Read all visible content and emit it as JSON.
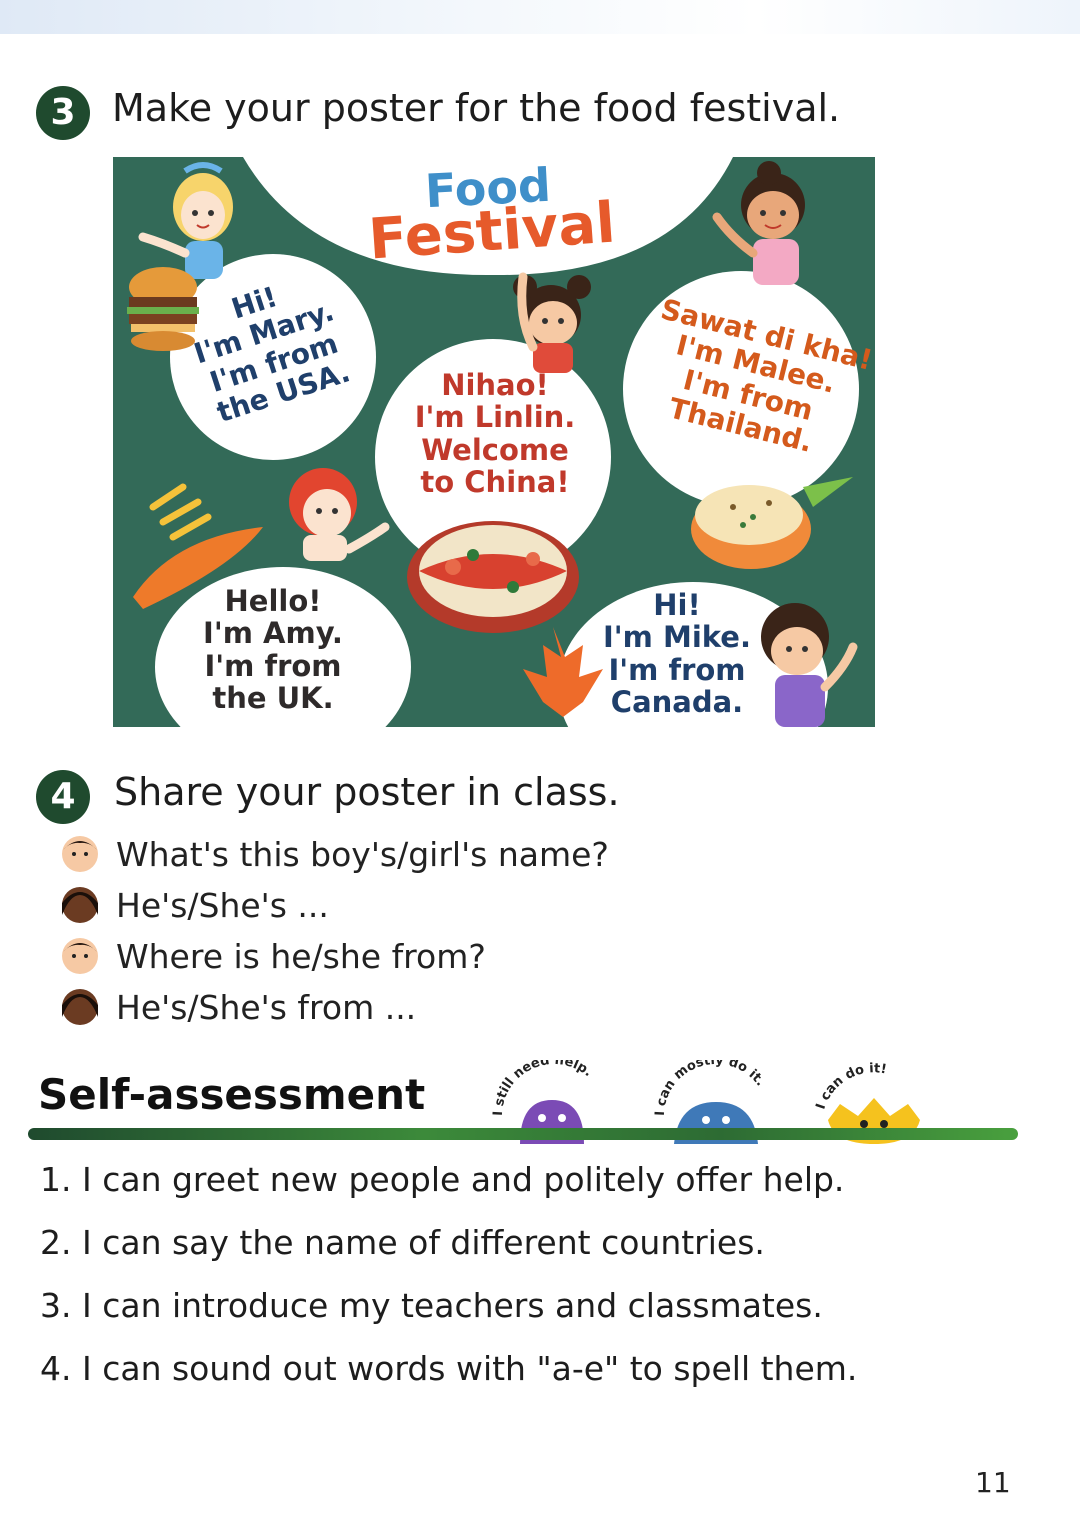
{
  "section3": {
    "number": "3",
    "title": "Make your poster for the food festival."
  },
  "poster": {
    "title_line1": "Food",
    "title_line2": "Festival",
    "bubbles": {
      "mary": [
        "Hi!",
        "I'm Mary.",
        "I'm from",
        "the USA."
      ],
      "linlin": [
        "Nihao!",
        "I'm Linlin.",
        "Welcome",
        "to China!"
      ],
      "malee": [
        "Sawat di kha!",
        "I'm Malee.",
        "I'm from",
        "Thailand."
      ],
      "amy": [
        "Hello!",
        "I'm Amy.",
        "I'm from",
        "the UK."
      ],
      "mike": [
        "Hi!",
        "I'm Mike.",
        "I'm from",
        "Canada."
      ]
    }
  },
  "section4": {
    "number": "4",
    "title": "Share your poster in class.",
    "dialogue": [
      "What's this boy's/girl's name?",
      "He's/She's ...",
      "Where is he/she from?",
      "He's/She's from ..."
    ]
  },
  "self_assessment": {
    "title": "Self-assessment",
    "ratings": [
      "I still need help.",
      "I can mostly do it.",
      "I can do it!"
    ],
    "statements": [
      "1. I can greet new people and politely offer help.",
      "2. I can say the name of different countries.",
      "3. I can introduce my teachers and classmates.",
      "4. I can sound out words with \"a-e\" to spell them."
    ]
  },
  "page_number": "11",
  "colors": {
    "poster_bg": "#336a58",
    "section_badge": "#1f4a2e",
    "title_food": "#3f8fc9",
    "title_festival": "#e65a2b"
  }
}
